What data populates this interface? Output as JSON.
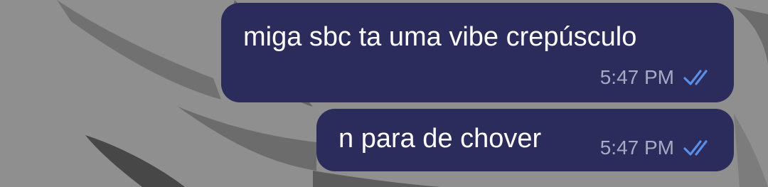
{
  "conversation": {
    "messages": [
      {
        "text": "miga sbc ta uma vibe crepúsculo",
        "time": "5:47 PM",
        "status_icon": "double-check-icon",
        "direction": "outgoing"
      },
      {
        "text": "n para de chover",
        "time": "5:47 PM",
        "status_icon": "double-check-icon",
        "direction": "outgoing"
      }
    ]
  },
  "colors": {
    "bubble": "#2b2b5c",
    "message_text": "#ffffff",
    "time_text": "#a9a9c6",
    "read_check": "#5b8ee6",
    "wallpaper": "#8e8e8e"
  }
}
